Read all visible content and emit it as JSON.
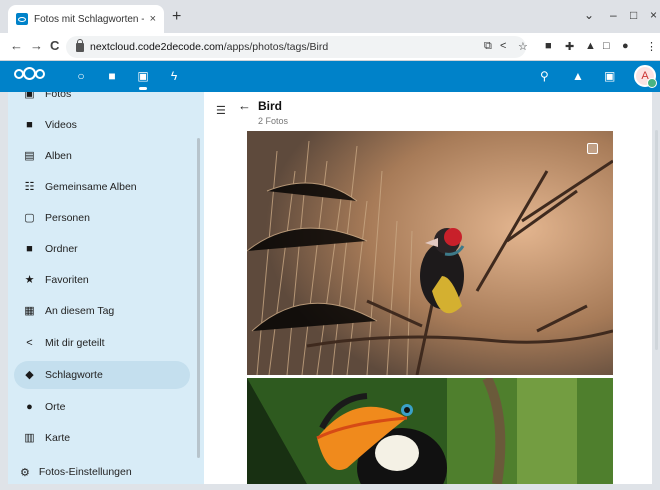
{
  "browser": {
    "tab_title": "Fotos mit Schlagworten - Fo",
    "tab_close": "×",
    "new_tab": "+",
    "url_host": "nextcloud.code2decode.com",
    "url_path": "/apps/photos/tags/Bird",
    "nav": {
      "back": "←",
      "forward": "→",
      "reload": "C"
    },
    "window": {
      "chevron": "⌄",
      "minimize": "–",
      "maximize": "□",
      "close": "×"
    }
  },
  "header": {
    "apps": [
      {
        "name": "dashboard",
        "icon": "○"
      },
      {
        "name": "files",
        "icon": "■"
      },
      {
        "name": "photos",
        "icon": "▣"
      },
      {
        "name": "activity",
        "icon": "ϟ"
      }
    ],
    "avatar_initial": "A"
  },
  "sidebar": {
    "items": [
      {
        "label": "Fotos",
        "icon": "▣"
      },
      {
        "label": "Videos",
        "icon": "■"
      },
      {
        "label": "Alben",
        "icon": "▤"
      },
      {
        "label": "Gemeinsame Alben",
        "icon": "☷"
      },
      {
        "label": "Personen",
        "icon": "▢"
      },
      {
        "label": "Ordner",
        "icon": "■"
      },
      {
        "label": "Favoriten",
        "icon": "★"
      },
      {
        "label": "An diesem Tag",
        "icon": "▦"
      },
      {
        "label": "Mit dir geteilt",
        "icon": "<"
      },
      {
        "label": "Schlagworte",
        "icon": "◆"
      },
      {
        "label": "Orte",
        "icon": "●"
      },
      {
        "label": "Karte",
        "icon": "▥"
      }
    ],
    "settings_label": "Fotos-Einstellungen",
    "active_index": 9
  },
  "main": {
    "title": "Bird",
    "count": "2 Fotos",
    "photos": [
      {
        "subject": "bird-on-branch-photo"
      },
      {
        "subject": "toucan-photo"
      }
    ]
  }
}
